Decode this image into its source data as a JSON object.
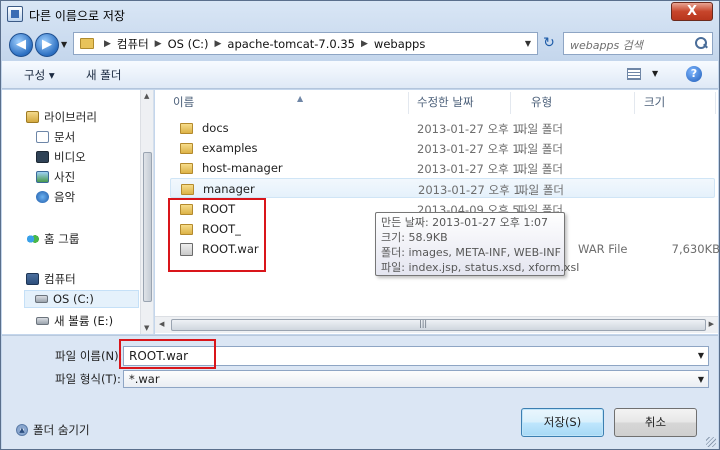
{
  "window": {
    "title": "다른 이름으로 저장",
    "close_label": "X"
  },
  "address": {
    "crumbs": [
      "컴퓨터",
      "OS (C:)",
      "apache-tomcat-7.0.35",
      "webapps"
    ],
    "separator": "▶",
    "search_placeholder": "webapps 검색"
  },
  "toolbar": {
    "organize": "구성 ▾",
    "new_folder": "새 폴더",
    "help": "?"
  },
  "nav": {
    "libraries": "라이브러리",
    "documents": "문서",
    "videos": "비디오",
    "pictures": "사진",
    "music": "음악",
    "homegroup": "홈 그룹",
    "computer": "컴퓨터",
    "drive_c": "OS (C:)",
    "drive_e": "새 볼륨 (E:)"
  },
  "columns": {
    "name": "이름",
    "date": "수정한 날짜",
    "type": "유형",
    "size": "크기"
  },
  "files": [
    {
      "name": "docs",
      "date": "2013-01-27 오후 1...",
      "type": "파일 폴더",
      "size": "",
      "icon": "folder"
    },
    {
      "name": "examples",
      "date": "2013-01-27 오후 1...",
      "type": "파일 폴더",
      "size": "",
      "icon": "folder"
    },
    {
      "name": "host-manager",
      "date": "2013-01-27 오후 1...",
      "type": "파일 폴더",
      "size": "",
      "icon": "folder"
    },
    {
      "name": "manager",
      "date": "2013-01-27 오후 1...",
      "type": "파일 폴더",
      "size": "",
      "icon": "folder"
    },
    {
      "name": "ROOT",
      "date": "2013-04-09 오후 5...",
      "type": "파일 폴더",
      "size": "",
      "icon": "folder"
    },
    {
      "name": "ROOT_",
      "date": "",
      "type": "",
      "size": "",
      "icon": "folder"
    },
    {
      "name": "ROOT.war",
      "date": "",
      "type": "WAR File",
      "size": "7,630KB",
      "icon": "war"
    }
  ],
  "tooltip": {
    "line1": "만든 날짜: 2013-01-27 오후 1:07",
    "line2": "크기: 58.9KB",
    "line3": "폴더: images, META-INF, WEB-INF",
    "line4": "파일: index.jsp, status.xsd, xform.xsl"
  },
  "form": {
    "filename_label": "파일 이름(N):",
    "filename_value": "ROOT.war",
    "filetype_label": "파일 형식(T):",
    "filetype_value": "*.war"
  },
  "footer": {
    "hide_folders": "폴더 숨기기",
    "save": "저장(S)",
    "cancel": "취소"
  },
  "colors": {
    "highlight_box": "#d9151a",
    "accent": "#2c6fc1"
  }
}
